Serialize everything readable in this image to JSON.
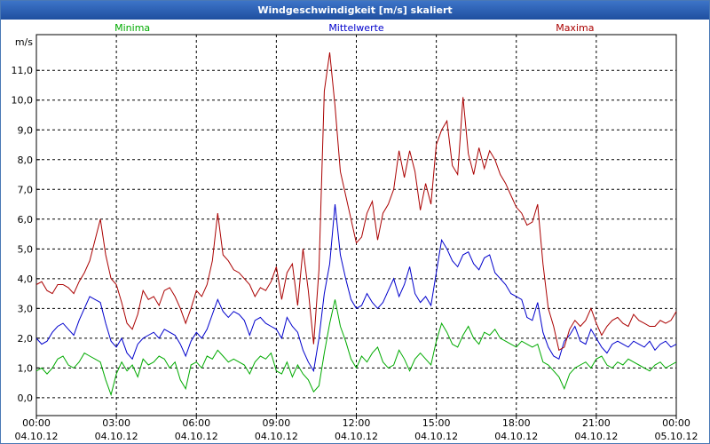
{
  "window": {
    "title": "Windgeschwindigkeit [m/s] skaliert"
  },
  "chart_data": {
    "type": "line",
    "title": "Windgeschwindigkeit [m/s] skaliert",
    "ylabel": "m/s",
    "ylim": [
      -0.6,
      12.2
    ],
    "xlim": [
      0,
      24
    ],
    "grid": true,
    "legend": "top",
    "y_ticks": [
      "0,0",
      "1,0",
      "2,0",
      "3,0",
      "4,0",
      "5,0",
      "6,0",
      "7,0",
      "8,0",
      "9,0",
      "10,0",
      "11,0"
    ],
    "y_tick_values": [
      0,
      1,
      2,
      3,
      4,
      5,
      6,
      7,
      8,
      9,
      10,
      11
    ],
    "x_ticks": [
      {
        "time": "00:00",
        "date": "04.10.12",
        "hour": 0
      },
      {
        "time": "03:00",
        "date": "04.10.12",
        "hour": 3
      },
      {
        "time": "06:00",
        "date": "04.10.12",
        "hour": 6
      },
      {
        "time": "09:00",
        "date": "04.10.12",
        "hour": 9
      },
      {
        "time": "12:00",
        "date": "04.10.12",
        "hour": 12
      },
      {
        "time": "15:00",
        "date": "04.10.12",
        "hour": 15
      },
      {
        "time": "18:00",
        "date": "04.10.12",
        "hour": 18
      },
      {
        "time": "21:00",
        "date": "04.10.12",
        "hour": 21
      },
      {
        "time": "00:00",
        "date": "05.10.12",
        "hour": 24
      }
    ],
    "x": [
      0,
      0.2,
      0.4,
      0.6,
      0.8,
      1,
      1.2,
      1.4,
      1.6,
      1.8,
      2,
      2.2,
      2.4,
      2.6,
      2.8,
      3,
      3.2,
      3.4,
      3.6,
      3.8,
      4,
      4.2,
      4.4,
      4.6,
      4.8,
      5,
      5.2,
      5.4,
      5.6,
      5.8,
      6,
      6.2,
      6.4,
      6.6,
      6.8,
      7,
      7.2,
      7.4,
      7.6,
      7.8,
      8,
      8.2,
      8.4,
      8.6,
      8.8,
      9,
      9.2,
      9.4,
      9.6,
      9.8,
      10,
      10.2,
      10.4,
      10.6,
      10.8,
      11,
      11.2,
      11.4,
      11.6,
      11.8,
      12,
      12.2,
      12.4,
      12.6,
      12.8,
      13,
      13.2,
      13.4,
      13.6,
      13.8,
      14,
      14.2,
      14.4,
      14.6,
      14.8,
      15,
      15.2,
      15.4,
      15.6,
      15.8,
      16,
      16.2,
      16.4,
      16.6,
      16.8,
      17,
      17.2,
      17.4,
      17.6,
      17.8,
      18,
      18.2,
      18.4,
      18.6,
      18.8,
      19,
      19.2,
      19.4,
      19.6,
      19.8,
      20,
      20.2,
      20.4,
      20.6,
      20.8,
      21,
      21.2,
      21.4,
      21.6,
      21.8,
      22,
      22.2,
      22.4,
      22.6,
      22.8,
      23,
      23.2,
      23.4,
      23.6,
      23.8,
      24
    ],
    "series": [
      {
        "name": "Minima",
        "color": "#00aa00",
        "values": [
          0.9,
          1.0,
          0.8,
          1.0,
          1.3,
          1.4,
          1.1,
          1.0,
          1.2,
          1.5,
          1.4,
          1.3,
          1.2,
          0.6,
          0.1,
          0.8,
          1.2,
          0.9,
          1.1,
          0.7,
          1.3,
          1.1,
          1.2,
          1.4,
          1.3,
          1.0,
          1.2,
          0.6,
          0.3,
          1.1,
          1.2,
          1.0,
          1.4,
          1.3,
          1.6,
          1.4,
          1.2,
          1.3,
          1.2,
          1.1,
          0.8,
          1.2,
          1.4,
          1.3,
          1.5,
          0.9,
          0.8,
          1.2,
          0.7,
          1.1,
          0.8,
          0.6,
          0.2,
          0.4,
          1.5,
          2.5,
          3.3,
          2.4,
          1.9,
          1.3,
          1.0,
          1.4,
          1.2,
          1.5,
          1.7,
          1.2,
          1.0,
          1.1,
          1.6,
          1.3,
          0.9,
          1.3,
          1.5,
          1.3,
          1.1,
          1.9,
          2.5,
          2.2,
          1.8,
          1.7,
          2.1,
          2.4,
          2.0,
          1.8,
          2.2,
          2.1,
          2.3,
          2.0,
          1.9,
          1.8,
          1.7,
          1.9,
          1.8,
          1.7,
          1.8,
          1.2,
          1.1,
          0.9,
          0.7,
          0.3,
          0.8,
          1.0,
          1.1,
          1.2,
          1.0,
          1.3,
          1.4,
          1.1,
          1.0,
          1.2,
          1.1,
          1.3,
          1.2,
          1.1,
          1.0,
          0.9,
          1.1,
          1.2,
          1.0,
          1.1,
          1.2,
          1.3,
          1.2
        ],
        "legend_label": "Minima"
      },
      {
        "name": "Mittelwerte",
        "color": "#0000cc",
        "values": [
          2.0,
          1.8,
          1.9,
          2.2,
          2.4,
          2.5,
          2.3,
          2.1,
          2.6,
          3.0,
          3.4,
          3.3,
          3.2,
          2.5,
          1.9,
          1.7,
          2.0,
          1.5,
          1.3,
          1.8,
          2.0,
          2.1,
          2.2,
          2.0,
          2.3,
          2.2,
          2.1,
          1.8,
          1.4,
          1.9,
          2.2,
          2.0,
          2.3,
          2.8,
          3.3,
          2.9,
          2.7,
          2.9,
          2.8,
          2.6,
          2.1,
          2.6,
          2.7,
          2.5,
          2.4,
          2.3,
          2.0,
          2.7,
          2.4,
          2.2,
          1.6,
          1.2,
          0.9,
          2.0,
          3.5,
          4.5,
          6.5,
          4.8,
          4.0,
          3.3,
          3.0,
          3.1,
          3.5,
          3.2,
          3.0,
          3.2,
          3.6,
          4.0,
          3.4,
          3.8,
          4.4,
          3.5,
          3.2,
          3.4,
          3.1,
          4.2,
          5.3,
          5.0,
          4.6,
          4.4,
          4.8,
          4.9,
          4.5,
          4.3,
          4.7,
          4.8,
          4.2,
          4.0,
          3.8,
          3.5,
          3.4,
          3.3,
          2.7,
          2.6,
          3.2,
          2.2,
          1.7,
          1.4,
          1.3,
          1.9,
          2.1,
          2.4,
          1.9,
          1.8,
          2.3,
          2.0,
          1.7,
          1.5,
          1.8,
          1.9,
          1.8,
          1.7,
          1.9,
          1.8,
          1.7,
          1.9,
          1.6,
          1.8,
          1.9,
          1.7,
          1.8,
          2.3,
          1.9
        ],
        "legend_label": "Mittelwerte"
      },
      {
        "name": "Maxima",
        "color": "#aa0000",
        "values": [
          3.8,
          3.9,
          3.6,
          3.5,
          3.8,
          3.8,
          3.7,
          3.5,
          3.9,
          4.2,
          4.6,
          5.3,
          6.0,
          4.8,
          4.0,
          3.8,
          3.2,
          2.5,
          2.3,
          2.8,
          3.6,
          3.3,
          3.4,
          3.1,
          3.6,
          3.7,
          3.4,
          3.0,
          2.5,
          3.0,
          3.6,
          3.4,
          3.8,
          4.6,
          6.2,
          4.8,
          4.6,
          4.3,
          4.2,
          4.0,
          3.8,
          3.4,
          3.7,
          3.6,
          3.9,
          4.4,
          3.3,
          4.2,
          4.5,
          3.1,
          5.0,
          3.6,
          1.8,
          4.3,
          10.3,
          11.6,
          9.8,
          7.6,
          6.8,
          6.0,
          5.2,
          5.4,
          6.2,
          6.6,
          5.3,
          6.2,
          6.5,
          7.0,
          8.3,
          7.4,
          8.3,
          7.6,
          6.3,
          7.2,
          6.5,
          8.5,
          9.0,
          9.3,
          7.8,
          7.5,
          10.1,
          8.2,
          7.5,
          8.4,
          7.7,
          8.3,
          8.0,
          7.5,
          7.2,
          6.8,
          6.4,
          6.2,
          5.8,
          5.9,
          6.5,
          4.5,
          3.0,
          2.4,
          1.6,
          1.7,
          2.3,
          2.6,
          2.4,
          2.6,
          3.0,
          2.5,
          2.1,
          2.4,
          2.6,
          2.7,
          2.5,
          2.4,
          2.8,
          2.6,
          2.5,
          2.4,
          2.4,
          2.6,
          2.5,
          2.6,
          2.9,
          3.7,
          2.8
        ],
        "legend_label": "Maxima"
      }
    ]
  }
}
